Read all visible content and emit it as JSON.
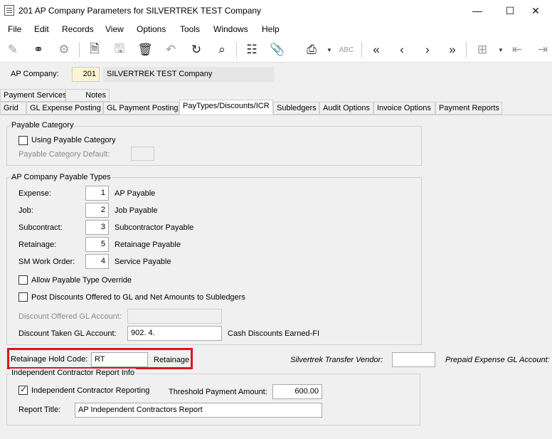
{
  "window": {
    "title": "201 AP Company Parameters for SILVERTREK TEST Company",
    "minimize": "—",
    "maximize": "☐",
    "close": "✕"
  },
  "menu": [
    "File",
    "Edit",
    "Records",
    "View",
    "Options",
    "Tools",
    "Windows",
    "Help"
  ],
  "toolbar_icons": [
    "edit-check-icon",
    "binoculars-icon",
    "gear-icon",
    "document-icon",
    "save-icon",
    "delete-icon",
    "undo-icon",
    "refresh-icon",
    "search-icon",
    "calculator-icon",
    "attach-icon",
    "print-icon",
    "spellcheck-icon",
    "first-record-icon",
    "previous-record-icon",
    "next-record-icon",
    "last-record-icon",
    "grid-settings-icon",
    "first-page-icon",
    "last-page-icon"
  ],
  "header": {
    "company_label": "AP Company:",
    "company_number": "201",
    "company_name": "SILVERTREK TEST Company"
  },
  "tabs_row1": [
    "Payment Services",
    "Notes"
  ],
  "tabs_row2": [
    "Grid",
    "GL Expense Posting",
    "GL Payment Posting",
    "PayTypes/Discounts/ICR",
    "Subledgers",
    "Audit Options",
    "Invoice Options",
    "Payment Reports"
  ],
  "active_tab": "PayTypes/Discounts/ICR",
  "payable_category": {
    "title": "Payable Category",
    "using_label": "Using Payable Category",
    "using_checked": false,
    "default_label": "Payable Category Default:",
    "default_value": ""
  },
  "payable_types": {
    "title": "AP Company Payable Types",
    "rows": [
      {
        "label": "Expense:",
        "value": "1",
        "desc": "AP Payable"
      },
      {
        "label": "Job:",
        "value": "2",
        "desc": "Job Payable"
      },
      {
        "label": "Subcontract:",
        "value": "3",
        "desc": "Subcontractor Payable"
      },
      {
        "label": "Retainage:",
        "value": "5",
        "desc": "Retainage Payable"
      },
      {
        "label": "SM Work Order:",
        "value": "4",
        "desc": "Service Payable"
      }
    ],
    "allow_override_label": "Allow Payable Type Override",
    "allow_override_checked": false,
    "post_discounts_label": "Post Discounts Offered to GL and Net Amounts to Subledgers",
    "post_discounts_checked": false,
    "discount_offered_label": "Discount Offered GL Account:",
    "discount_offered_value": "",
    "discount_taken_label": "Discount Taken GL Account:",
    "discount_taken_value": "902. 4.",
    "discount_taken_desc": "Cash Discounts Earned-FI"
  },
  "retainage": {
    "label": "Retainage Hold Code:",
    "value": "RT",
    "desc": "Retainage"
  },
  "silvertrek": {
    "vendor_label": "Silvertrek Transfer Vendor:",
    "vendor_value": "",
    "prepaid_label": "Prepaid Expense GL Account:"
  },
  "icr": {
    "title": "Independent Contractor Report Info",
    "reporting_label": "Independent Contractor Reporting",
    "reporting_checked": true,
    "threshold_label": "Threshold Payment Amount:",
    "threshold_value": "600.00",
    "report_title_label": "Report Title:",
    "report_title_value": "AP Independent Contractors Report"
  }
}
